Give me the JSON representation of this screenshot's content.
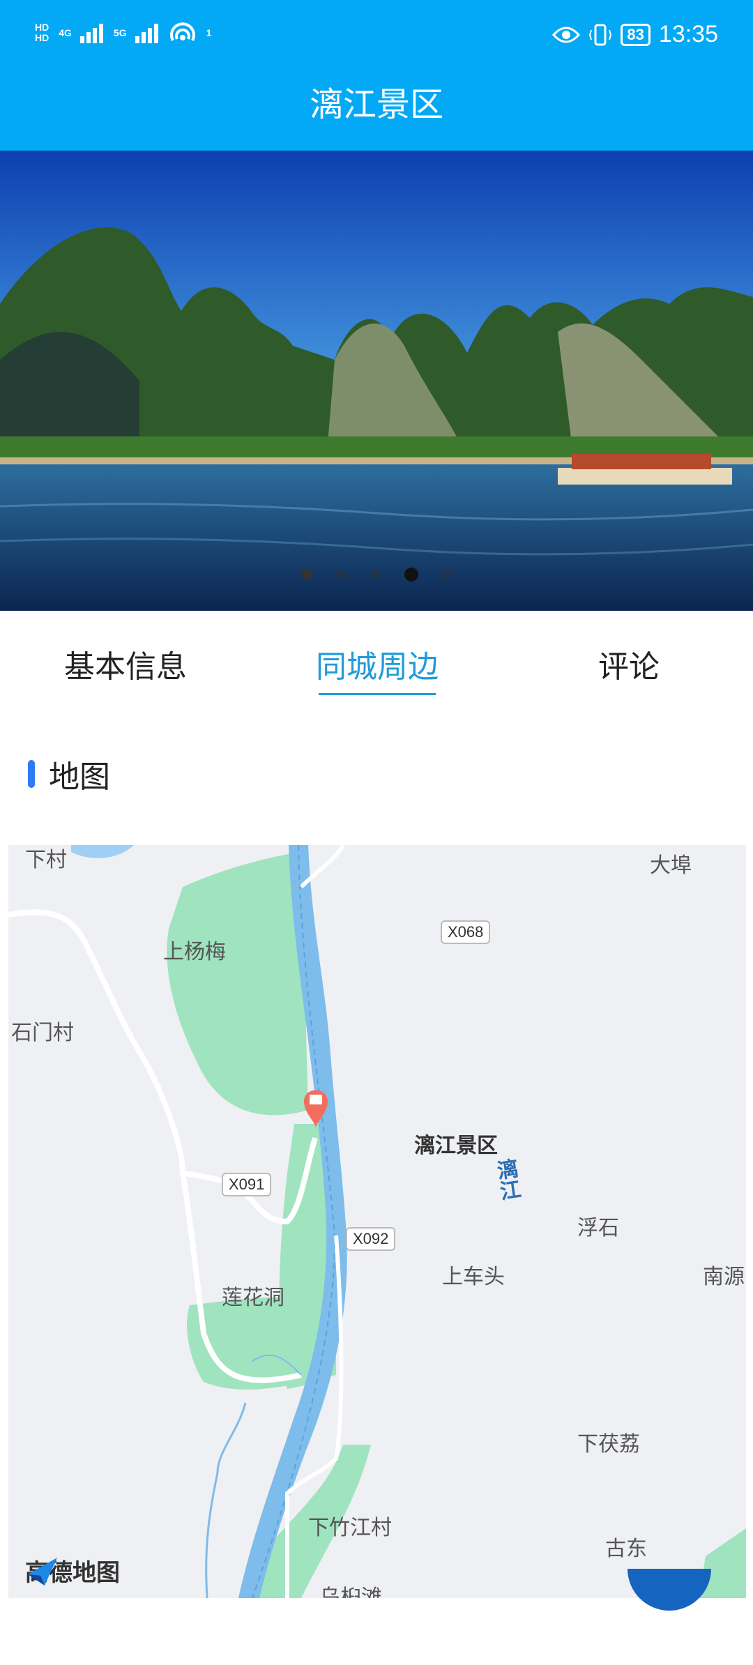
{
  "status_bar": {
    "left": {
      "hd1": "HD",
      "hd2": "HD",
      "net1": "4G",
      "net2": "5G",
      "hotspot_count": "1"
    },
    "battery": "83",
    "time": "13:35"
  },
  "header": {
    "title": "漓江景区"
  },
  "tabs": [
    {
      "label": "基本信息",
      "active": false
    },
    {
      "label": "同城周边",
      "active": true
    },
    {
      "label": "评论",
      "active": false
    }
  ],
  "section": {
    "title": "地图"
  },
  "map": {
    "places": [
      "下村",
      "大埠",
      "上杨梅",
      "石门村",
      "浮石",
      "南源",
      "莲花洞",
      "上车头",
      "下茯荔",
      "下竹江村",
      "古东",
      "乌桕滩"
    ],
    "roads": [
      "X068",
      "X091",
      "X092"
    ],
    "river": "漓江",
    "poi": "漓江景区",
    "brand": "高德地图"
  },
  "colors": {
    "primary": "#03A9F4",
    "active_tab": "#1E9BDB",
    "section_bar": "#2F7BF2"
  }
}
